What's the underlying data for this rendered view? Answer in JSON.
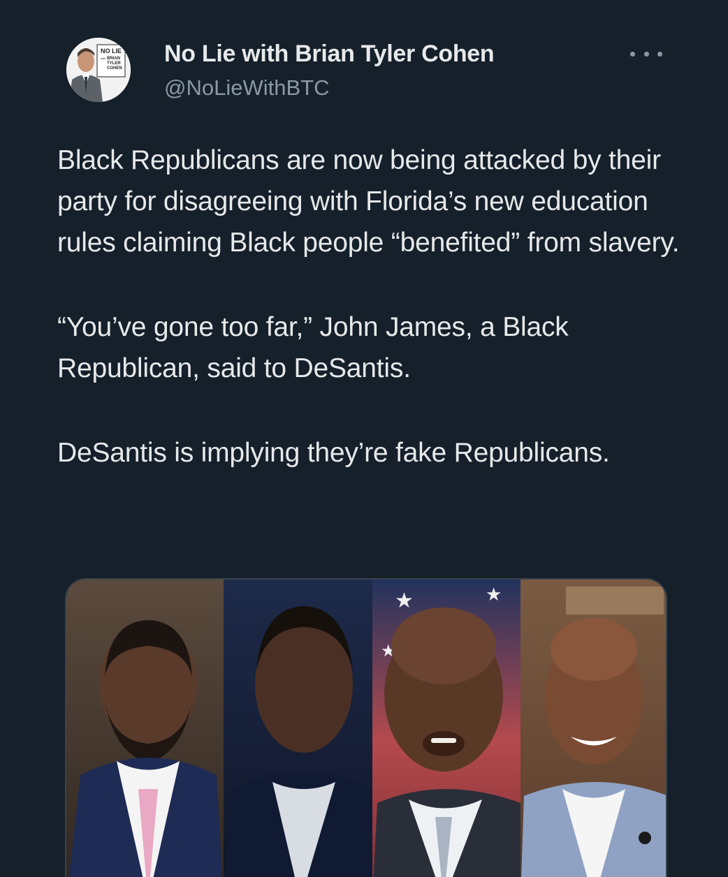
{
  "author": {
    "display_name": "No Lie with Brian Tyler Cohen",
    "handle": "@NoLieWithBTC",
    "avatar_icon": "profile-avatar",
    "avatar_logo_text": [
      "NO LIE",
      "with",
      "BRIAN",
      "TYLER",
      "COHEN"
    ]
  },
  "menu": {
    "icon": "more-options-icon"
  },
  "tweet": {
    "paragraphs": [
      "Black Republicans are now being attacked by their party for disagreeing with Florida’s new education rules claiming Black people “benefited” from slavery.",
      "“You’ve gone too far,” John James, a Black Republican, said to DeSantis.",
      "DeSantis is implying they’re fake Republicans."
    ]
  },
  "media": {
    "icon": "attached-photo",
    "panels": 4
  },
  "colors": {
    "background": "#15202b",
    "text_primary": "#e7e9ea",
    "text_secondary": "#8b98a5",
    "border": "#38444d"
  }
}
